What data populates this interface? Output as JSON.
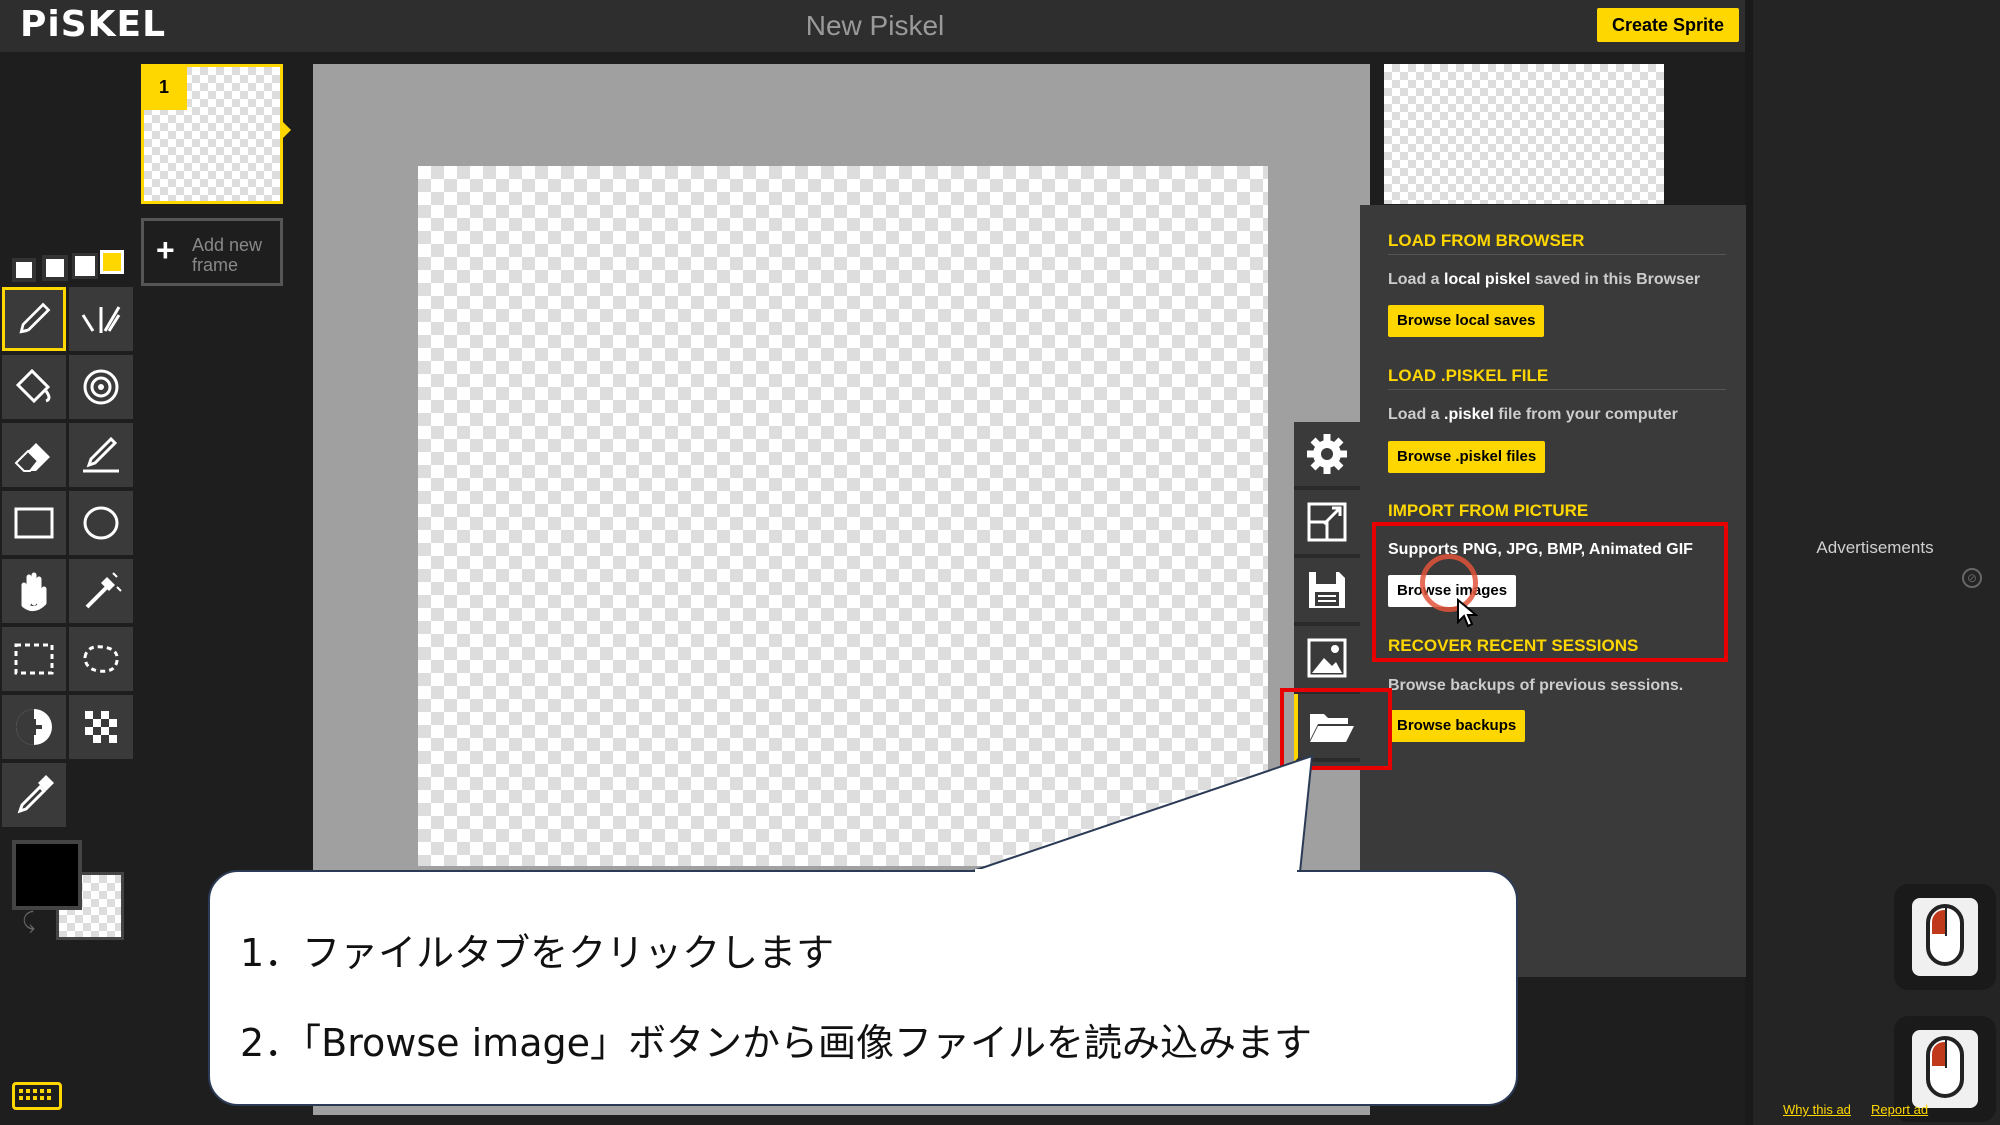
{
  "app": {
    "logo": "PiSKEL",
    "document_title": "New Piskel",
    "create_sprite_label": "Create Sprite"
  },
  "frames": {
    "frame_number": "1",
    "add_new_frame_line1": "Add new",
    "add_new_frame_line2": "frame"
  },
  "tools": [
    {
      "name": "pen-tool-icon"
    },
    {
      "name": "vertical-mirror-pen-icon"
    },
    {
      "name": "paint-bucket-icon"
    },
    {
      "name": "paint-all-same-color-icon"
    },
    {
      "name": "eraser-icon"
    },
    {
      "name": "stroke-tool-icon"
    },
    {
      "name": "rectangle-tool-icon"
    },
    {
      "name": "circle-tool-icon"
    },
    {
      "name": "move-hand-icon"
    },
    {
      "name": "shape-selection-icon"
    },
    {
      "name": "rectangle-selection-icon"
    },
    {
      "name": "lasso-selection-icon"
    },
    {
      "name": "lighten-tool-icon"
    },
    {
      "name": "dithering-tool-icon"
    },
    {
      "name": "color-picker-icon"
    }
  ],
  "colors": {
    "primary": "#000000",
    "accent": "#ffd700",
    "highlight": "#e60000"
  },
  "import_panel": {
    "load_from_browser": {
      "title": "LOAD FROM BROWSER",
      "desc_prefix": "Load a ",
      "desc_bold": "local piskel",
      "desc_suffix": " saved in this Browser",
      "button": "Browse local saves"
    },
    "load_piskel_file": {
      "title": "LOAD .PISKEL FILE",
      "desc_prefix": "Load a ",
      "desc_bold": ".piskel",
      "desc_suffix": " file from your computer",
      "button": "Browse .piskel files"
    },
    "import_from_picture": {
      "title": "IMPORT FROM PICTURE",
      "desc": "Supports PNG, JPG, BMP, Animated GIF",
      "button": "Browse images"
    },
    "recover_sessions": {
      "title": "RECOVER RECENT SESSIONS",
      "desc": "Browse backups of previous sessions.",
      "button": "Browse backups"
    }
  },
  "side_tabs": [
    "settings-icon",
    "resize-icon",
    "save-icon",
    "export-image-icon",
    "import-folder-icon"
  ],
  "ads": {
    "label": "Advertisements",
    "why_this_ad": "Why this ad",
    "report_ad": "Report ad"
  },
  "callout": {
    "line1": "1．ファイルタブをクリックします",
    "line2": "2．「Browse image」ボタンから画像ファイルを読み込みます"
  }
}
